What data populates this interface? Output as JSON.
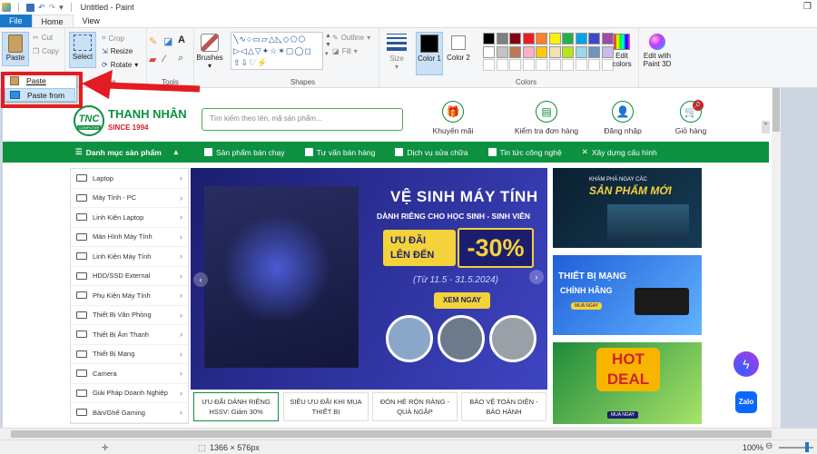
{
  "window": {
    "title": "Untitled - Paint"
  },
  "tabs": [
    "File",
    "Home",
    "View"
  ],
  "ribbon": {
    "clipboard": {
      "paste": "Paste",
      "cut": "Cut",
      "copy": "Copy"
    },
    "image": {
      "label": "Image",
      "select": "Select",
      "crop": "Crop",
      "resize": "Resize",
      "rotate": "Rotate"
    },
    "tools": {
      "label": "Tools"
    },
    "brushes": "Brushes",
    "shapes": {
      "label": "Shapes",
      "outline": "Outline",
      "fill": "Fill"
    },
    "size": "Size",
    "color1": "Color 1",
    "color2": "Color 2",
    "colors_label": "Colors",
    "edit_colors": "Edit colors",
    "edit_paint3d": "Edit with Paint 3D",
    "palette": [
      "#000000",
      "#7f7f7f",
      "#880015",
      "#ed1c24",
      "#ff7f27",
      "#fff200",
      "#22b14c",
      "#00a2e8",
      "#3f48cc",
      "#a349a4",
      "#ffffff",
      "#c3c3c3",
      "#b97a57",
      "#ffaec9",
      "#ffc90e",
      "#efe4b0",
      "#b5e61d",
      "#99d9ea",
      "#7092be",
      "#c8bfe7"
    ]
  },
  "paste_menu": {
    "paste": "Paste",
    "paste_from": "Paste from"
  },
  "website": {
    "logo": {
      "brand": "THANH NHÂN",
      "since": "SINCE 1994",
      "badge": "TNC",
      "badge_sub": "COMPUTER"
    },
    "search_placeholder": "Tìm kiếm theo tên, mã sản phẩm...",
    "header_links": [
      {
        "label": "Khuyến mãi",
        "icon": "gift-icon",
        "glyph": "🎁"
      },
      {
        "label": "Kiểm tra đơn hàng",
        "icon": "receipt-icon",
        "glyph": "▤"
      },
      {
        "label": "Đăng nhập",
        "icon": "user-icon",
        "glyph": "👤"
      },
      {
        "label": "Giỏ hàng",
        "icon": "cart-icon",
        "glyph": "🛒"
      }
    ],
    "cart_count": "0",
    "nav": [
      "Danh mục sản phẩm",
      "Sản phẩm bán chạy",
      "Tư vấn bán hàng",
      "Dịch vụ sửa chữa",
      "Tin tức công nghệ",
      "Xây dựng cấu hình"
    ],
    "categories": [
      "Laptop",
      "Máy Tính - PC",
      "Linh Kiện Laptop",
      "Màn Hình Máy Tính",
      "Linh Kiện Máy Tính",
      "HDD/SSD External",
      "Phụ Kiện Máy Tính",
      "Thiết Bị Văn Phòng",
      "Thiết Bị Âm Thanh",
      "Thiết Bị Mạng",
      "Camera",
      "Giải Pháp Doanh Nghiệp",
      "Bàn/Ghế Gaming"
    ],
    "banner": {
      "title": "VỆ SINH MÁY TÍNH",
      "subtitle": "DÀNH RIÊNG CHO HỌC SINH - SINH VIÊN",
      "offer": "ƯU ĐÃI LÊN ĐẾN",
      "discount": "-30%",
      "dates": "(Từ 11.5 - 31.5.2024)",
      "cta": "XEM NGAY"
    },
    "promos": [
      "ƯU ĐÃI DÀNH RIÊNG HSSV: Giảm 30%",
      "SIÊU ƯU ĐÃI KHI MUA THIẾT BỊ",
      "ĐÓN HÈ RỘN RÀNG - QUÀ NGẬP",
      "BẢO VỆ TOÀN DIỆN - BẢO HÀNH"
    ],
    "side_banners": [
      {
        "title": "SẢN PHẨM MỚI",
        "kicker": "KHÁM PHÁ NGAY CÁC"
      },
      {
        "title": "THIẾT BỊ MẠNG",
        "sub": "CHÍNH HÃNG",
        "btn": "MUA NGAY"
      },
      {
        "title": "HOT DEAL",
        "btn": "MUA NGAY"
      }
    ],
    "chat_labels": {
      "zalo": "Zalo"
    }
  },
  "status": {
    "dimensions": "1366 × 576px",
    "zoom": "100%"
  }
}
